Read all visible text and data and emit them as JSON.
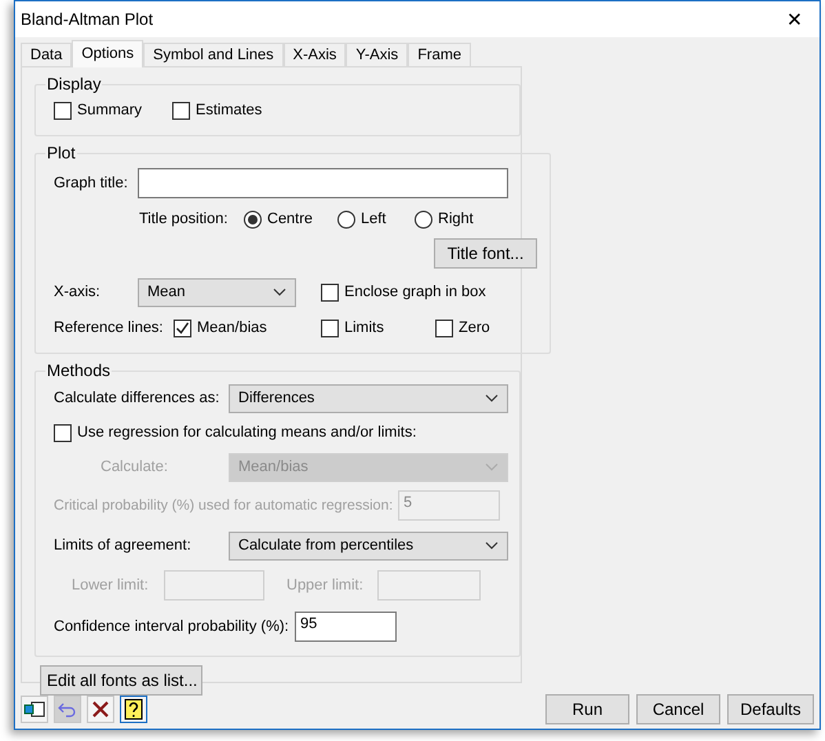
{
  "window": {
    "title": "Bland-Altman Plot",
    "close": "✕"
  },
  "tabs": [
    {
      "label": "Data",
      "selected": false
    },
    {
      "label": "Options",
      "selected": true
    },
    {
      "label": "Symbol and Lines",
      "selected": false
    },
    {
      "label": "X-Axis",
      "selected": false
    },
    {
      "label": "Y-Axis",
      "selected": false
    },
    {
      "label": "Frame",
      "selected": false
    }
  ],
  "display": {
    "legend": "Display",
    "options": [
      {
        "label": "Summary",
        "checked": false
      },
      {
        "label": "Estimates",
        "checked": false
      }
    ]
  },
  "plot": {
    "legend": "Plot",
    "graph_title": {
      "label": "Graph title:"
    },
    "title_position": {
      "label": "Title position:",
      "options": [
        {
          "label": "Centre",
          "selected": true
        },
        {
          "label": "Left",
          "selected": false
        },
        {
          "label": "Right",
          "selected": false
        }
      ]
    },
    "title_font_button": "Title font...",
    "x_axis": {
      "label": "X-axis:",
      "value": "Mean"
    },
    "enclose": {
      "label": "Enclose graph in box",
      "checked": false
    },
    "reference_lines": {
      "label": "Reference lines:",
      "options": [
        {
          "label": "Mean/bias",
          "checked": true
        },
        {
          "label": "Limits",
          "checked": false
        },
        {
          "label": "Zero",
          "checked": false
        }
      ]
    }
  },
  "methods": {
    "legend": "Methods",
    "calculate_differences": {
      "label": "Calculate differences as:",
      "value": "Differences"
    },
    "use_regression": {
      "label": "Use regression for calculating means and/or limits:",
      "checked": false
    },
    "calculate": {
      "label": "Calculate:",
      "value": "Mean/bias",
      "disabled": true
    },
    "critical_probability": {
      "label": "Critical probability (%) used for automatic regression:",
      "value": "5",
      "disabled": true
    },
    "limits_of_agreement": {
      "label": "Limits of agreement:",
      "value": "Calculate from percentiles"
    },
    "lower_limit": {
      "label": "Lower limit:",
      "disabled": true
    },
    "upper_limit": {
      "label": "Upper limit:",
      "disabled": true
    },
    "confidence": {
      "label": "Confidence interval probability (%):",
      "value": "95"
    }
  },
  "edit_fonts_button": "Edit all fonts as list...",
  "buttons": [
    "Run",
    "Cancel",
    "Defaults"
  ]
}
